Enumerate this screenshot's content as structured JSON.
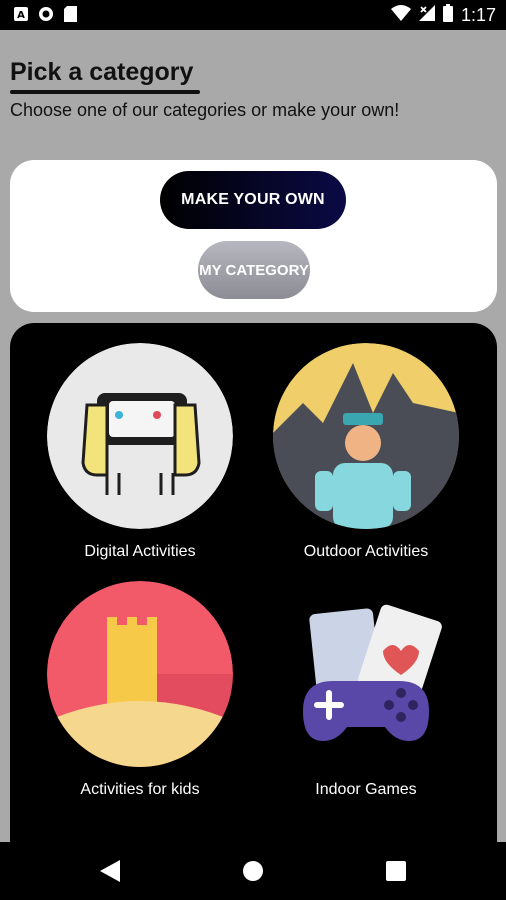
{
  "status_bar": {
    "time": "1:17",
    "left_icons": [
      "font-a-icon",
      "record-icon",
      "sd-card-icon"
    ],
    "right_icons": [
      "wifi-icon",
      "no-signal-icon",
      "battery-icon"
    ]
  },
  "header": {
    "title": "Pick a category",
    "subtitle": "Choose one of our categories or make your own!"
  },
  "actions": {
    "make_own_label": "MAKE YOUR OWN",
    "my_category_label": "MY CATEGORY"
  },
  "categories": [
    {
      "label": "Digital Activities",
      "icon": "handheld-console-icon"
    },
    {
      "label": "Outdoor Activities",
      "icon": "hiker-mountains-icon"
    },
    {
      "label": "Activities for kids",
      "icon": "sandcastle-icon"
    },
    {
      "label": "Indoor Games",
      "icon": "gamepad-cards-icon"
    }
  ],
  "nav_bar": {
    "buttons": [
      "back-icon",
      "home-icon",
      "recents-icon"
    ]
  },
  "colors": {
    "background": "#a9a9a9",
    "card_dark": "#000000",
    "make_own_gradient_end": "#0b0a46",
    "my_category_grey": "#9e9ea6"
  }
}
